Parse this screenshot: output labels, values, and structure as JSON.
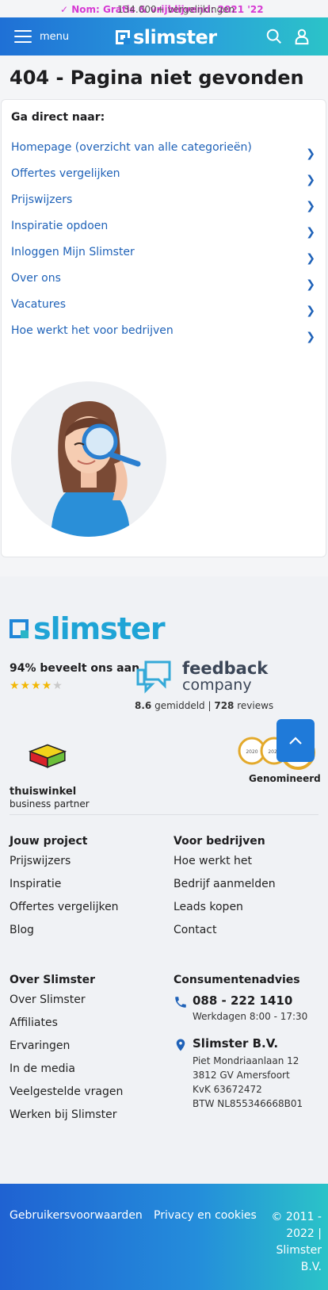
{
  "ticker": {
    "text1": "✓ Nom: Gratis & vrijblijvend: 2021 '22",
    "text2": "134.000+ vergelijkingen"
  },
  "header": {
    "menu_label": "menu",
    "logo_text": "slimster",
    "icons": [
      "search-icon",
      "user-icon"
    ]
  },
  "main": {
    "title": "404 - Pagina niet gevonden",
    "card_heading": "Ga direct naar:",
    "links": [
      "Homepage (overzicht van alle categorieën)",
      "Offertes vergelijken",
      "Prijswijzers",
      "Inspiratie opdoen",
      "Inloggen Mijn Slimster",
      "Over ons",
      "Vacatures",
      "Hoe werkt het voor bedrijven"
    ]
  },
  "footer": {
    "logo_text": "slimster",
    "recommend": "94% beveelt ons aan",
    "stars_full": "★★★★",
    "stars_half": "★",
    "feedback": {
      "name_line1": "feedback",
      "name_line2": "company",
      "score_value": "8.6",
      "score_mid": " gemiddeld | ",
      "reviews_value": "728",
      "reviews_suffix": " reviews"
    },
    "thuiswinkel": {
      "line1": "thuiswinkel",
      "line2": "business partner"
    },
    "award_label": "Genomineerd",
    "award_years": [
      "2020",
      "2021",
      "2022"
    ],
    "columns": {
      "project": {
        "heading": "Jouw project",
        "items": [
          "Prijswijzers",
          "Inspiratie",
          "Offertes vergelijken",
          "Blog"
        ]
      },
      "business": {
        "heading": "Voor bedrijven",
        "items": [
          "Hoe werkt het",
          "Bedrijf aanmelden",
          "Leads kopen",
          "Contact"
        ]
      },
      "about": {
        "heading": "Over Slimster",
        "items": [
          "Over Slimster",
          "Affiliates",
          "Ervaringen",
          "In de media",
          "Veelgestelde vragen",
          "Werken bij Slimster"
        ]
      },
      "consumer": {
        "heading": "Consumentenadvies",
        "phone": "088 - 222 1410",
        "hours": "Werkdagen 8:00 - 17:30",
        "company": "Slimster B.V.",
        "address": [
          "Piet Mondriaanlaan 12",
          "3812 GV Amersfoort",
          "KvK 63672472",
          "BTW NL855346668B01"
        ]
      }
    },
    "bottom": {
      "terms": "Gebruikersvoorwaarden",
      "privacy": "Privacy en cookies",
      "copyright_lines": [
        "© 2011 -",
        "2022 |",
        "Slimster",
        "B.V."
      ]
    }
  },
  "colors": {
    "brand_blue": "#1f70d6",
    "brand_teal": "#2bc3c8",
    "link_blue": "#1f62b8",
    "star_gold": "#f2b705"
  }
}
